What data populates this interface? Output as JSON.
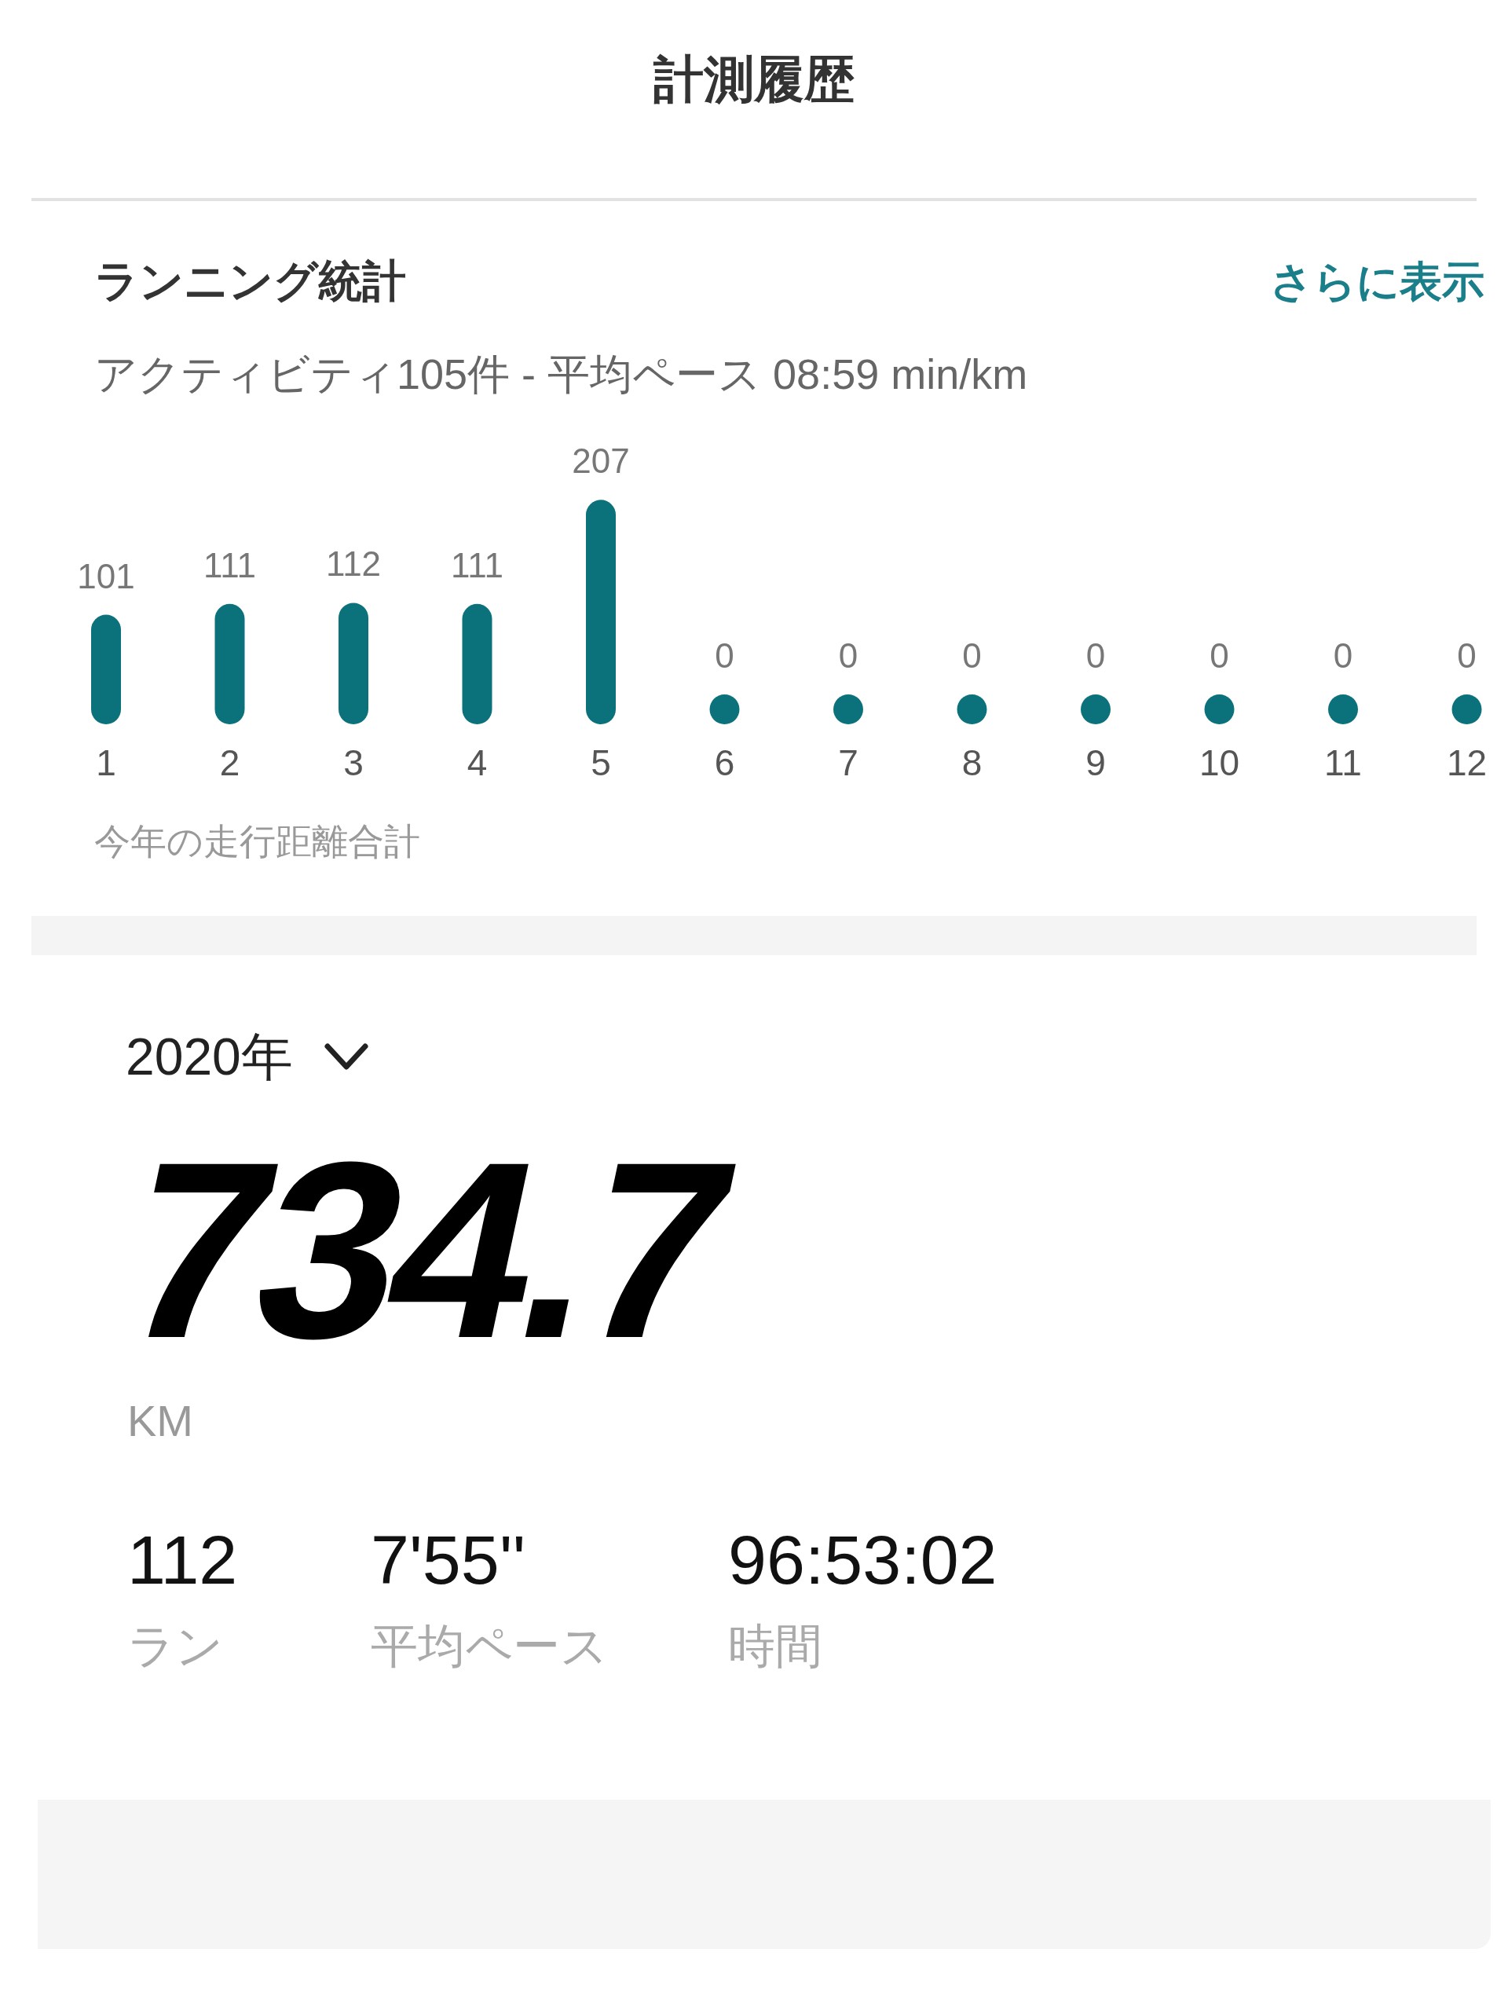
{
  "header": {
    "title": "計測履歴"
  },
  "stats_card": {
    "title": "ランニング統計",
    "more_link": "さらに表示",
    "summary": "アクティビティ105件 - 平均ペース 08:59 min/km",
    "chart_data": {
      "type": "bar",
      "categories": [
        "1",
        "2",
        "3",
        "4",
        "5",
        "6",
        "7",
        "8",
        "9",
        "10",
        "11",
        "12"
      ],
      "values": [
        101,
        111,
        112,
        111,
        207,
        0,
        0,
        0,
        0,
        0,
        0,
        0
      ],
      "data_labels": true
    },
    "caption": "今年の走行距離合計"
  },
  "year_summary": {
    "year": "2020年",
    "distance": "734.7",
    "unit": "KM",
    "stats": [
      {
        "value": "112",
        "label": "ラン"
      },
      {
        "value": "7'55''",
        "label": "平均ペース"
      },
      {
        "value": "96:53:02",
        "label": "時間"
      }
    ]
  }
}
